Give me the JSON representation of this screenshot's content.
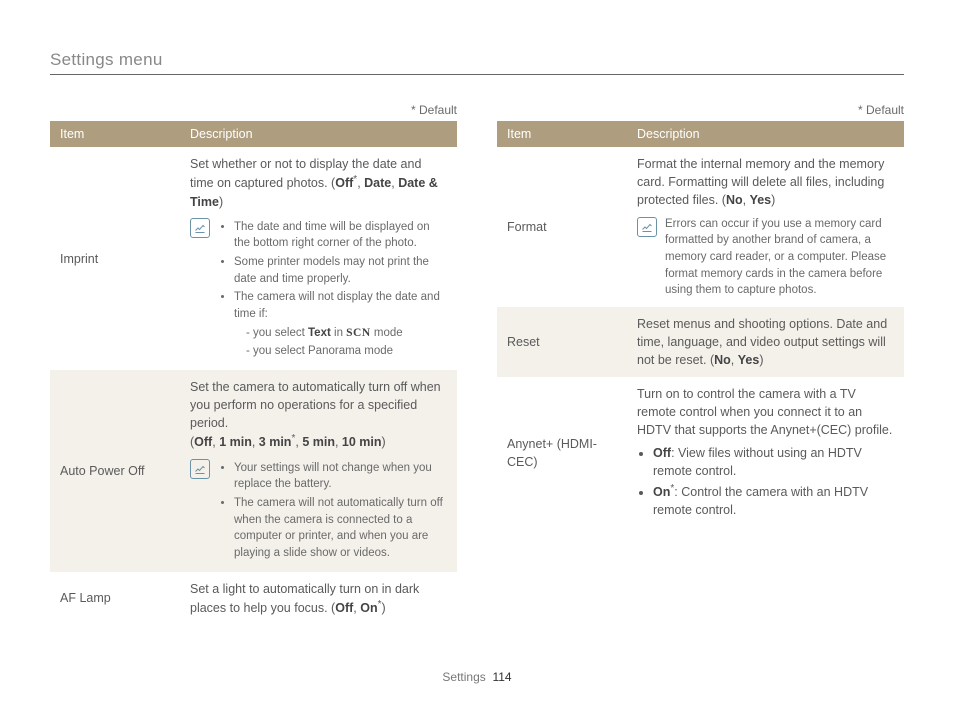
{
  "page_title": "Settings menu",
  "default_marker": "* Default",
  "footer_label": "Settings",
  "footer_page": "114",
  "headers": {
    "item": "Item",
    "description": "Description"
  },
  "left": {
    "imprint": {
      "item": "Imprint",
      "lead_a": "Set whether or not to display the date and time on captured photos. (",
      "opt1": "Off",
      "opt2": "Date",
      "opt3": "Date & Time",
      "note1": "The date and time will be displayed on the bottom right corner of the photo.",
      "note2": "Some printer models may not print the date and time properly.",
      "note3a": "The camera will not display the date and time if:",
      "note3b": "you select ",
      "note3b_bold": "Text",
      "note3b_tail": " in ",
      "note3b_mode": " mode",
      "note3c": "you select Panorama mode",
      "scn_label": "SCN"
    },
    "apo": {
      "item": "Auto Power Off",
      "lead": "Set the camera to automatically turn off when you perform no operations for a specified period.",
      "opts_open": "(",
      "o1": "Off",
      "o2": "1 min",
      "o3": "3 min",
      "o4": "5 min",
      "o5": "10 min",
      "opts_close": ")",
      "n1": "Your settings will not change when you replace the battery.",
      "n2": "The camera will not automatically turn off when the camera is connected to a computer or printer, and when you are playing a slide show or videos."
    },
    "af": {
      "item": "AF Lamp",
      "lead_a": "Set a light to automatically turn on in dark places to help you focus. (",
      "o1": "Off",
      "o2": "On"
    }
  },
  "right": {
    "format": {
      "item": "Format",
      "lead_a": "Format the internal memory and the memory card. Formatting will delete all files, including protected files. (",
      "o1": "No",
      "o2": "Yes",
      "note": "Errors can occur if you use a memory card formatted by another brand of camera, a memory card reader, or a computer. Please format memory cards in the camera before using them to capture photos."
    },
    "reset": {
      "item": "Reset",
      "lead_a": "Reset menus and shooting options. Date and time, language, and video output settings will not be reset. (",
      "o1": "No",
      "o2": "Yes"
    },
    "anynet": {
      "item": "Anynet+ (HDMI-CEC)",
      "lead": "Turn on to control the camera with a TV remote control when you connect it to an HDTV that supports the Anynet+(CEC) profile.",
      "b1_head": "Off",
      "b1_tail": ": View files without using an HDTV remote control.",
      "b2_head": "On",
      "b2_tail": ": Control the camera with an HDTV remote control."
    }
  }
}
